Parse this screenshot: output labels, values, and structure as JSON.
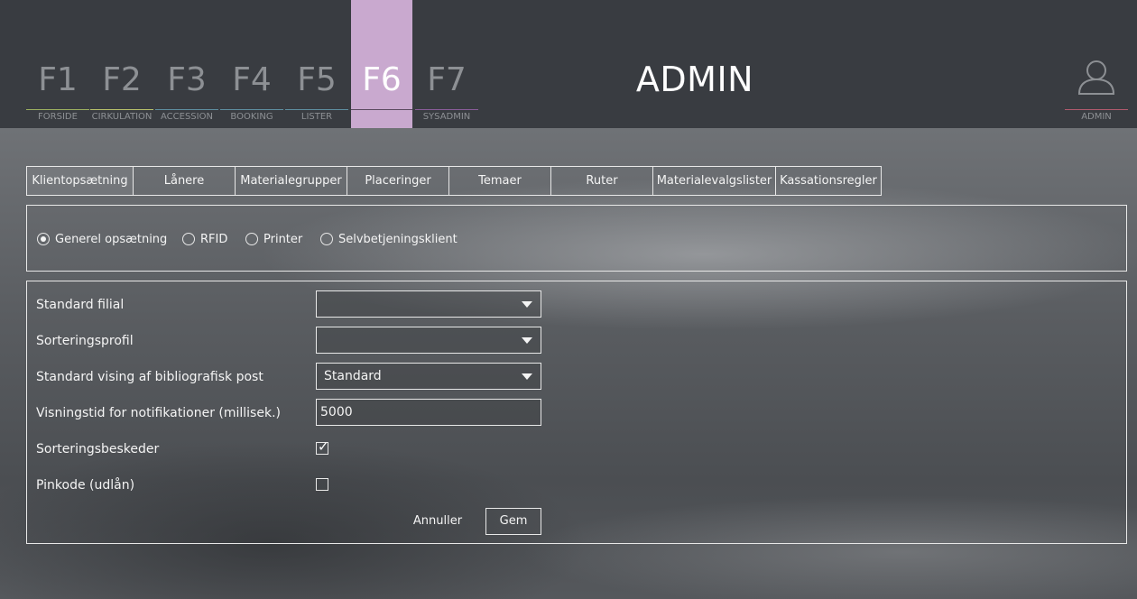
{
  "nav": {
    "keys": [
      {
        "key": "F1",
        "label": "FORSIDE",
        "color": "#9cb060"
      },
      {
        "key": "F2",
        "label": "CIRKULATION",
        "color": "#b7c06a"
      },
      {
        "key": "F3",
        "label": "ACCESSION",
        "color": "#5e8fa0"
      },
      {
        "key": "F4",
        "label": "BOOKING",
        "color": "#5e8fa0"
      },
      {
        "key": "F5",
        "label": "LISTER",
        "color": "#5e8fa0"
      },
      {
        "key": "F6",
        "label": "",
        "color": "#c9a9cf"
      },
      {
        "key": "F7",
        "label": "SYSADMIN",
        "color": "#8a5c9a"
      }
    ],
    "active_index": 5
  },
  "header": {
    "title": "ADMIN",
    "user_label": "ADMIN",
    "user_icon": "user-icon"
  },
  "tabs": [
    {
      "label": "Klientopsætning"
    },
    {
      "label": "Lånere"
    },
    {
      "label": "Materialegrupper"
    },
    {
      "label": "Placeringer"
    },
    {
      "label": "Temaer"
    },
    {
      "label": "Ruter"
    },
    {
      "label": "Materialevalgslister"
    },
    {
      "label": "Kassationsregler"
    }
  ],
  "radios": {
    "options": [
      {
        "label": "Generel opsætning",
        "checked": true
      },
      {
        "label": "RFID",
        "checked": false
      },
      {
        "label": "Printer",
        "checked": false
      },
      {
        "label": "Selvbetjeningsklient",
        "checked": false
      }
    ]
  },
  "form": {
    "standard_filial": {
      "label": "Standard filial",
      "value": ""
    },
    "sorteringsprofil": {
      "label": "Sorteringsprofil",
      "value": ""
    },
    "visning": {
      "label": "Standard vising af bibliografisk post",
      "value": "Standard"
    },
    "notifikation": {
      "label": "Visningstid for notifikationer (millisek.)",
      "value": "5000"
    },
    "sorteringsbeskeder": {
      "label": "Sorteringsbeskeder",
      "checked": true,
      "mark": "✓"
    },
    "pinkode": {
      "label": "Pinkode (udlån)",
      "checked": false
    }
  },
  "actions": {
    "cancel_label": "Annuller",
    "save_label": "Gem"
  }
}
